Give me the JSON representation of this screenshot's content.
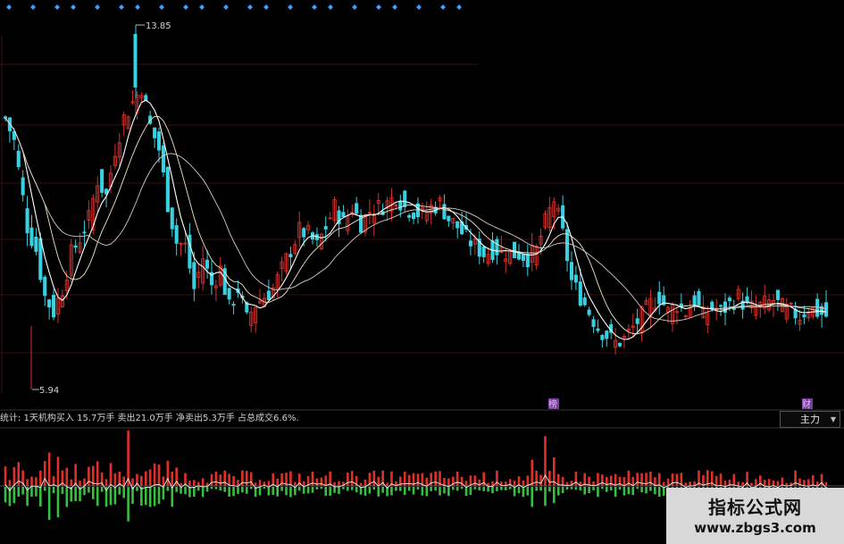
{
  "chart_data": {
    "type": "candlestick",
    "annotations": {
      "high_label": "13.85",
      "low_label": "5.94",
      "marker_1": "榜",
      "marker_2": "财"
    },
    "indicator_panel": {
      "info_text": "统计: 1天机构买入 15.7万手 卖出21.0万手 净卖出5.3万手 占总成交6.6%.",
      "selector_label": "主力"
    },
    "colors": {
      "up": "#d9302a",
      "down": "#39d0e0",
      "ma_short": "#ffffff",
      "ma_long": "#d8c8c8",
      "inflow": "#e0302a",
      "outflow": "#35c040",
      "top_markers": "#3aa0ff",
      "marker_badge": "#a050c8"
    },
    "close_path": [
      [
        0,
        12.2
      ],
      [
        2,
        11.6
      ],
      [
        5,
        9.4
      ],
      [
        7,
        8.8
      ],
      [
        9,
        7.6
      ],
      [
        11,
        7.2
      ],
      [
        13,
        7.8
      ],
      [
        15,
        8.7
      ],
      [
        17,
        9.1
      ],
      [
        19,
        9.6
      ],
      [
        21,
        10.6
      ],
      [
        23,
        10.2
      ],
      [
        25,
        11.4
      ],
      [
        27,
        12.2
      ],
      [
        29,
        12.6
      ],
      [
        31,
        13.0
      ],
      [
        33,
        12.0
      ],
      [
        35,
        11.4
      ],
      [
        37,
        10.0
      ],
      [
        39,
        9.0
      ],
      [
        41,
        8.9
      ],
      [
        43,
        7.8
      ],
      [
        45,
        8.6
      ],
      [
        47,
        7.9
      ],
      [
        49,
        8.3
      ],
      [
        51,
        7.3
      ],
      [
        53,
        7.8
      ],
      [
        55,
        7.0
      ],
      [
        57,
        7.4
      ],
      [
        59,
        7.6
      ],
      [
        61,
        7.8
      ],
      [
        63,
        8.3
      ],
      [
        65,
        8.8
      ],
      [
        67,
        9.3
      ],
      [
        69,
        9.2
      ],
      [
        71,
        8.9
      ],
      [
        73,
        9.4
      ],
      [
        75,
        9.9
      ],
      [
        77,
        9.5
      ],
      [
        79,
        9.9
      ],
      [
        81,
        9.5
      ],
      [
        83,
        9.8
      ],
      [
        85,
        9.9
      ],
      [
        87,
        10.0
      ],
      [
        89,
        10.2
      ],
      [
        91,
        9.9
      ],
      [
        93,
        9.8
      ],
      [
        95,
        9.7
      ],
      [
        97,
        9.9
      ],
      [
        99,
        10.0
      ],
      [
        101,
        9.6
      ],
      [
        103,
        9.4
      ],
      [
        105,
        9.1
      ],
      [
        107,
        8.9
      ],
      [
        109,
        8.7
      ],
      [
        111,
        8.8
      ],
      [
        113,
        8.8
      ],
      [
        115,
        8.7
      ],
      [
        117,
        8.7
      ],
      [
        119,
        8.6
      ],
      [
        121,
        8.8
      ],
      [
        123,
        9.5
      ],
      [
        125,
        10.1
      ],
      [
        127,
        9.2
      ],
      [
        129,
        8.0
      ],
      [
        131,
        7.6
      ],
      [
        133,
        7.2
      ],
      [
        135,
        6.8
      ],
      [
        137,
        6.6
      ],
      [
        139,
        6.4
      ],
      [
        141,
        6.5
      ],
      [
        143,
        6.8
      ],
      [
        145,
        7.1
      ],
      [
        147,
        7.4
      ],
      [
        149,
        7.6
      ],
      [
        151,
        7.2
      ],
      [
        153,
        7.4
      ],
      [
        155,
        7.2
      ],
      [
        157,
        7.5
      ],
      [
        159,
        7.1
      ],
      [
        161,
        7.3
      ],
      [
        163,
        7.2
      ],
      [
        165,
        7.4
      ],
      [
        167,
        7.6
      ],
      [
        169,
        7.3
      ],
      [
        171,
        7.3
      ],
      [
        173,
        7.4
      ],
      [
        175,
        7.5
      ],
      [
        177,
        7.3
      ],
      [
        179,
        7.2
      ],
      [
        181,
        7.1
      ],
      [
        183,
        7.3
      ],
      [
        185,
        7.2
      ],
      [
        187,
        7.1
      ]
    ],
    "ylim": [
      5.2,
      14.6
    ],
    "x_count": 188
  },
  "top_markers": {
    "count": 22
  }
}
